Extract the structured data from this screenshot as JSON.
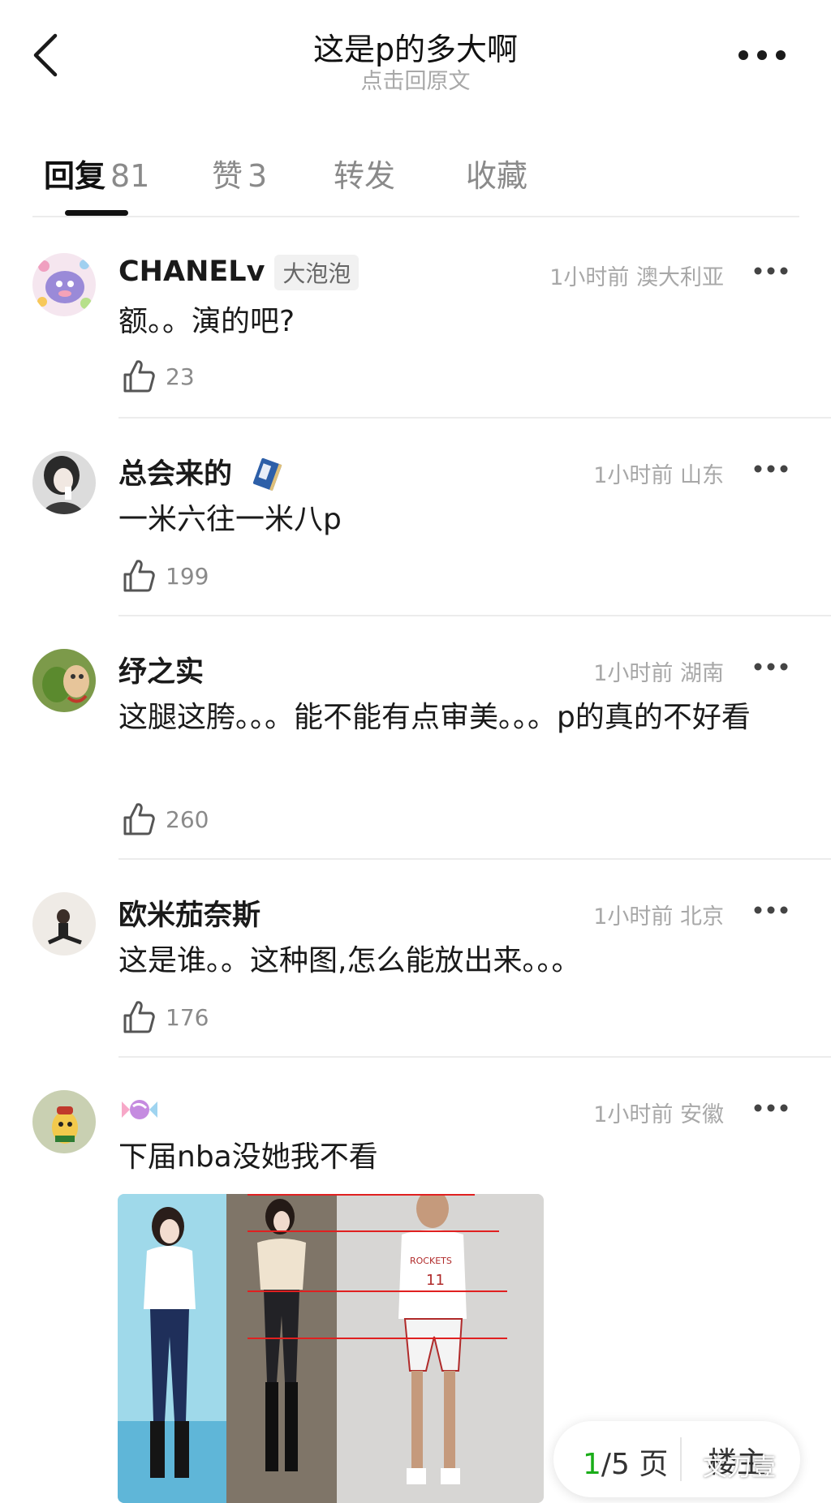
{
  "header": {
    "title": "这是p的多大啊",
    "subtitle": "点击回原文"
  },
  "tabs": [
    {
      "label": "回复",
      "count": "81"
    },
    {
      "label": "赞",
      "count": "3"
    },
    {
      "label": "转发",
      "count": ""
    },
    {
      "label": "收藏",
      "count": ""
    }
  ],
  "comments": [
    {
      "name": "CHANELv",
      "badge": "大泡泡",
      "time": "1小时前",
      "location": "澳大利亚",
      "text": "额。。演的吧?",
      "likes": "23"
    },
    {
      "name": "总会来的",
      "time": "1小时前",
      "location": "山东",
      "text": "一米六往一米八p",
      "likes": "199"
    },
    {
      "name": "纾之实",
      "time": "1小时前",
      "location": "湖南",
      "text": "这腿这胯。。。能不能有点审美。。。p的真的不好看",
      "likes": "260"
    },
    {
      "name": "欧米茄奈斯",
      "time": "1小时前",
      "location": "北京",
      "text": "这是谁。。这种图,怎么能放出来。。。",
      "likes": "176"
    },
    {
      "name": "",
      "time": "1小时前",
      "location": "安徽",
      "text": "下届nba没她我不看",
      "likes": ""
    }
  ],
  "photo": {
    "jersey_text": "ROCKETS",
    "jersey_number": "11"
  },
  "pager": {
    "current": "1",
    "total_text": "/5 页",
    "next_label": "楼主"
  },
  "watermark": "文刀壹",
  "colors": {
    "accent_green": "#1aad19",
    "meta_gray": "#a8a8a8",
    "divider": "#ececec"
  }
}
